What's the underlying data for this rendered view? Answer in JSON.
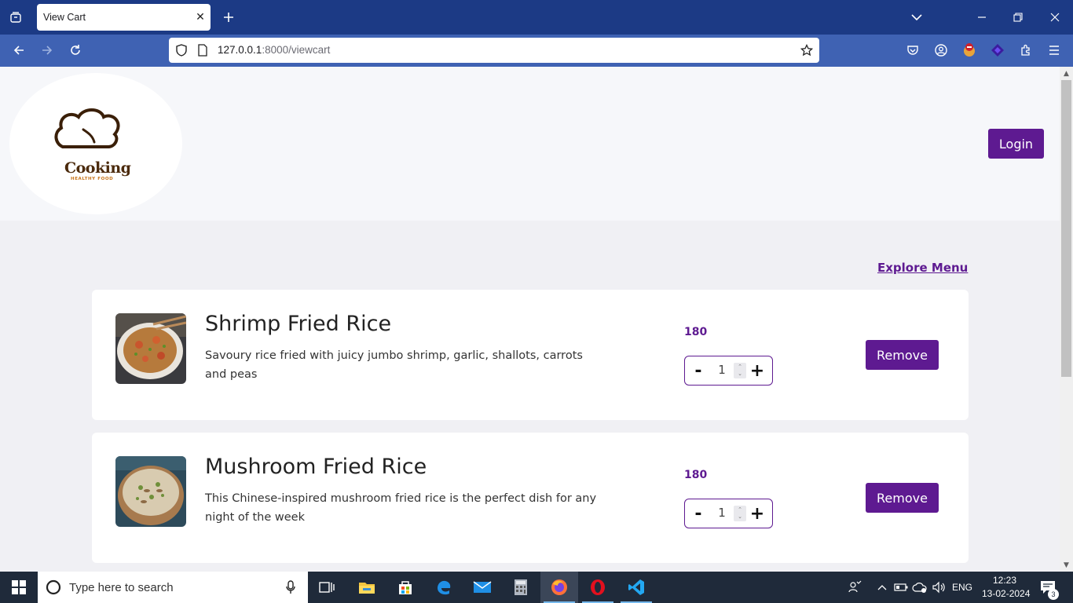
{
  "browser": {
    "tab_title": "View Cart",
    "url_host": "127.0.0.1",
    "url_rest": ":8000/viewcart"
  },
  "header": {
    "logo_text": "Cooking",
    "logo_subtext": "HEALTHY FOOD",
    "login_label": "Login"
  },
  "main": {
    "explore_label": "Explore Menu",
    "cart_items": [
      {
        "title": "Shrimp Fried Rice",
        "description": "Savoury rice fried with juicy jumbo shrimp, garlic, shallots, carrots and peas",
        "price": "180",
        "quantity": "1",
        "minus_label": "-",
        "plus_label": "+",
        "remove_label": "Remove"
      },
      {
        "title": "Mushroom Fried Rice",
        "description": "This Chinese-inspired mushroom fried rice is the perfect dish for any night of the week",
        "price": "180",
        "quantity": "1",
        "minus_label": "-",
        "plus_label": "+",
        "remove_label": "Remove"
      }
    ]
  },
  "taskbar": {
    "search_placeholder": "Type here to search",
    "language": "ENG",
    "time": "12:23",
    "date": "13-02-2024",
    "notification_count": "3"
  },
  "colors": {
    "brand_purple": "#5e1a91",
    "browser_tabbar": "#1c3a85",
    "browser_navbar": "#3f62b3"
  }
}
